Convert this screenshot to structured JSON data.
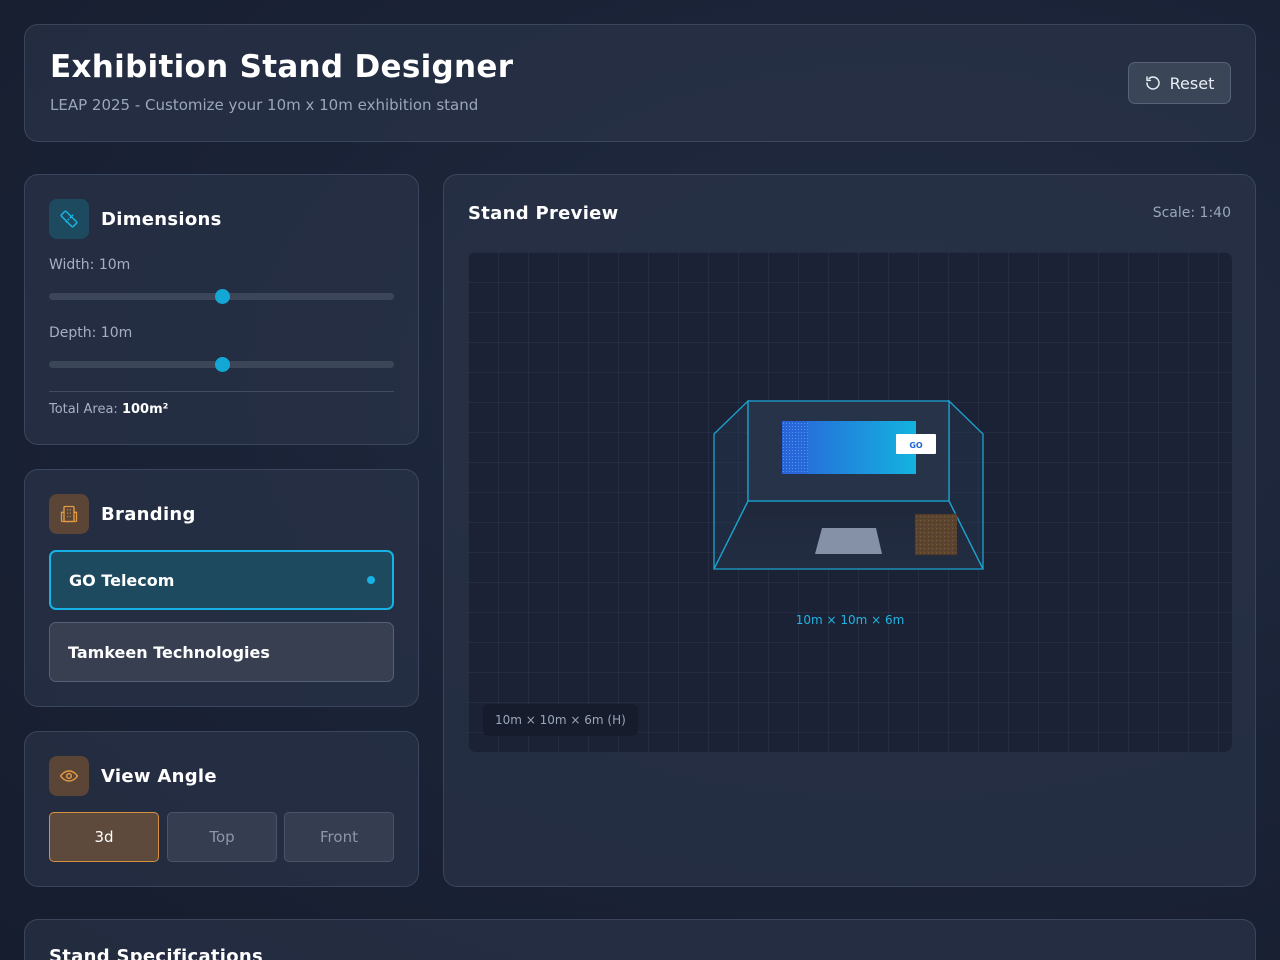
{
  "header": {
    "title": "Exhibition Stand Designer",
    "subtitle": "LEAP 2025 - Customize your 10m x 10m exhibition stand",
    "reset_label": "Reset",
    "reset_icon": "rotate-ccw-icon"
  },
  "dimensions": {
    "title": "Dimensions",
    "icon": "ruler-icon",
    "width_label": "Width: 10m",
    "width_value": 0.5,
    "depth_label": "Depth: 10m",
    "depth_value": 0.5,
    "total_area_label": "Total Area:",
    "total_area_value": "100m²"
  },
  "branding": {
    "title": "Branding",
    "icon": "building-icon",
    "options": [
      {
        "label": "GO Telecom",
        "selected": true
      },
      {
        "label": "Tamkeen Technologies",
        "selected": false
      }
    ]
  },
  "view_angle": {
    "title": "View Angle",
    "icon": "eye-icon",
    "options": [
      {
        "label": "3d",
        "selected": true
      },
      {
        "label": "Top",
        "selected": false
      },
      {
        "label": "Front",
        "selected": false
      }
    ]
  },
  "preview": {
    "title": "Stand Preview",
    "scale": "Scale: 1:40",
    "screen_logo": "GO",
    "dimensions_caption": "10m × 10m × 6m",
    "dimensions_badge": "10m × 10m × 6m (H)"
  },
  "specs": {
    "title": "Stand Specifications"
  },
  "colors": {
    "accent": "#17b2e3",
    "view_accent": "#d5913f",
    "background": "#1a2236"
  }
}
